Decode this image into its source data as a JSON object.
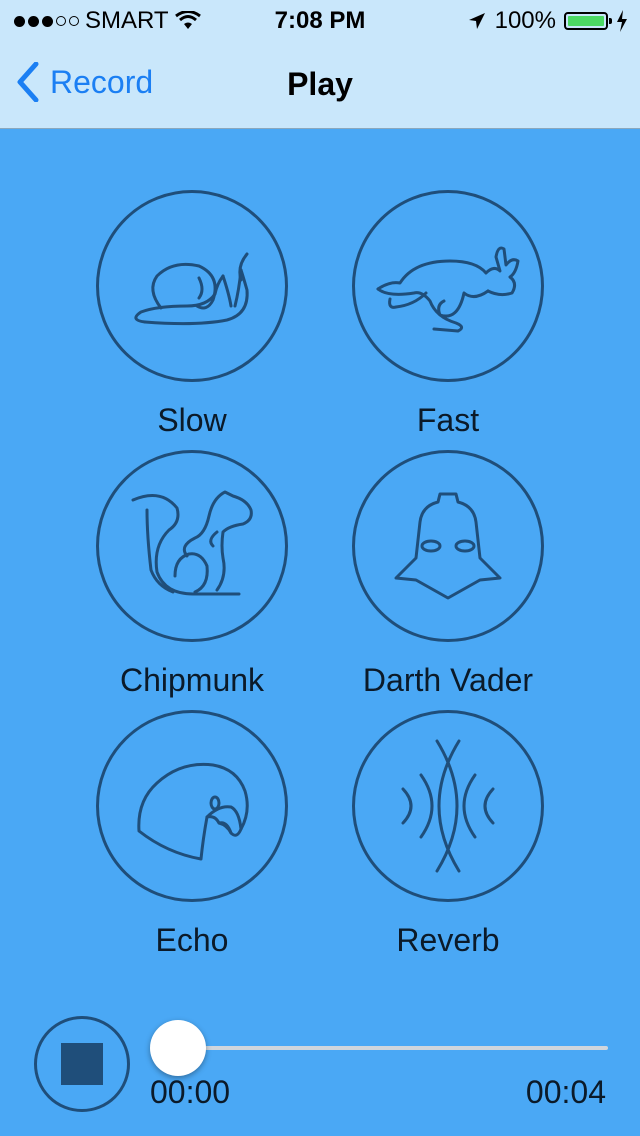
{
  "status_bar": {
    "carrier": "SMART",
    "time": "7:08 PM",
    "battery": "100%"
  },
  "nav": {
    "back_label": "Record",
    "title": "Play"
  },
  "effects": [
    {
      "label": "Slow",
      "icon": "snail-icon"
    },
    {
      "label": "Fast",
      "icon": "rabbit-icon"
    },
    {
      "label": "Chipmunk",
      "icon": "chipmunk-icon"
    },
    {
      "label": "Darth Vader",
      "icon": "darth-vader-icon"
    },
    {
      "label": "Echo",
      "icon": "parrot-icon"
    },
    {
      "label": "Reverb",
      "icon": "reverb-waves-icon"
    }
  ],
  "player": {
    "current_time": "00:00",
    "total_time": "00:04",
    "progress": 0
  },
  "colors": {
    "background": "#4aa8f5",
    "bar": "#c9e7fb",
    "accent": "#1b7ff3",
    "icon_stroke": "#1f4e7a"
  }
}
